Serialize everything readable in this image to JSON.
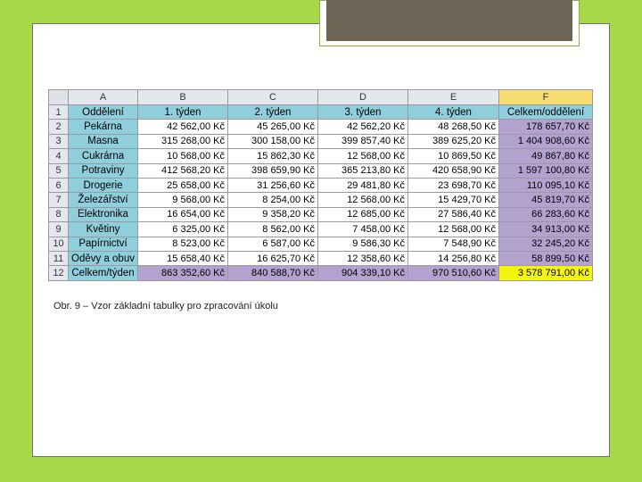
{
  "table": {
    "column_letters": [
      "A",
      "B",
      "C",
      "D",
      "E",
      "F"
    ],
    "headers": [
      "Oddělení",
      "1. týden",
      "2. týden",
      "3. týden",
      "4. týden",
      "Celkem/oddělení"
    ],
    "rows": [
      {
        "n": "2",
        "name": "Pekárna",
        "w1": "42 562,00 Kč",
        "w2": "45 265,00 Kč",
        "w3": "42 562,20 Kč",
        "w4": "48 268,50 Kč",
        "total": "178 657,70 Kč"
      },
      {
        "n": "3",
        "name": "Masna",
        "w1": "315 268,00 Kč",
        "w2": "300 158,00 Kč",
        "w3": "399 857,40 Kč",
        "w4": "389 625,20 Kč",
        "total": "1 404 908,60 Kč"
      },
      {
        "n": "4",
        "name": "Cukrárna",
        "w1": "10 568,00 Kč",
        "w2": "15 862,30 Kč",
        "w3": "12 568,00 Kč",
        "w4": "10 869,50 Kč",
        "total": "49 867,80 Kč"
      },
      {
        "n": "5",
        "name": "Potraviny",
        "w1": "412 568,20 Kč",
        "w2": "398 659,90 Kč",
        "w3": "365 213,80 Kč",
        "w4": "420 658,90 Kč",
        "total": "1 597 100,80 Kč"
      },
      {
        "n": "6",
        "name": "Drogerie",
        "w1": "25 658,00 Kč",
        "w2": "31 256,60 Kč",
        "w3": "29 481,80 Kč",
        "w4": "23 698,70 Kč",
        "total": "110 095,10 Kč"
      },
      {
        "n": "7",
        "name": "Železářství",
        "w1": "9 568,00 Kč",
        "w2": "8 254,00 Kč",
        "w3": "12 568,00 Kč",
        "w4": "15 429,70 Kč",
        "total": "45 819,70 Kč"
      },
      {
        "n": "8",
        "name": "Elektronika",
        "w1": "16 654,00 Kč",
        "w2": "9 358,20 Kč",
        "w3": "12 685,00 Kč",
        "w4": "27 586,40 Kč",
        "total": "66 283,60 Kč"
      },
      {
        "n": "9",
        "name": "Květiny",
        "w1": "6 325,00 Kč",
        "w2": "8 562,00 Kč",
        "w3": "7 458,00 Kč",
        "w4": "12 568,00 Kč",
        "total": "34 913,00 Kč"
      },
      {
        "n": "10",
        "name": "Papírnictví",
        "w1": "8 523,00 Kč",
        "w2": "6 587,00 Kč",
        "w3": "9 586,30 Kč",
        "w4": "7 548,90 Kč",
        "total": "32 245,20 Kč"
      },
      {
        "n": "11",
        "name": "Oděvy a obuv",
        "w1": "15 658,40 Kč",
        "w2": "16 625,70 Kč",
        "w3": "12 358,60 Kč",
        "w4": "14 256,80 Kč",
        "total": "58 899,50 Kč"
      }
    ],
    "totals": {
      "n": "12",
      "name": "Celkem/týden",
      "w1": "863 352,60 Kč",
      "w2": "840 588,70 Kč",
      "w3": "904 339,10 Kč",
      "w4": "970 510,60 Kč",
      "total": "3 578 791,00 Kč"
    }
  },
  "caption": "Obr. 9 – Vzor základní tabulky pro zpracování úkolu"
}
